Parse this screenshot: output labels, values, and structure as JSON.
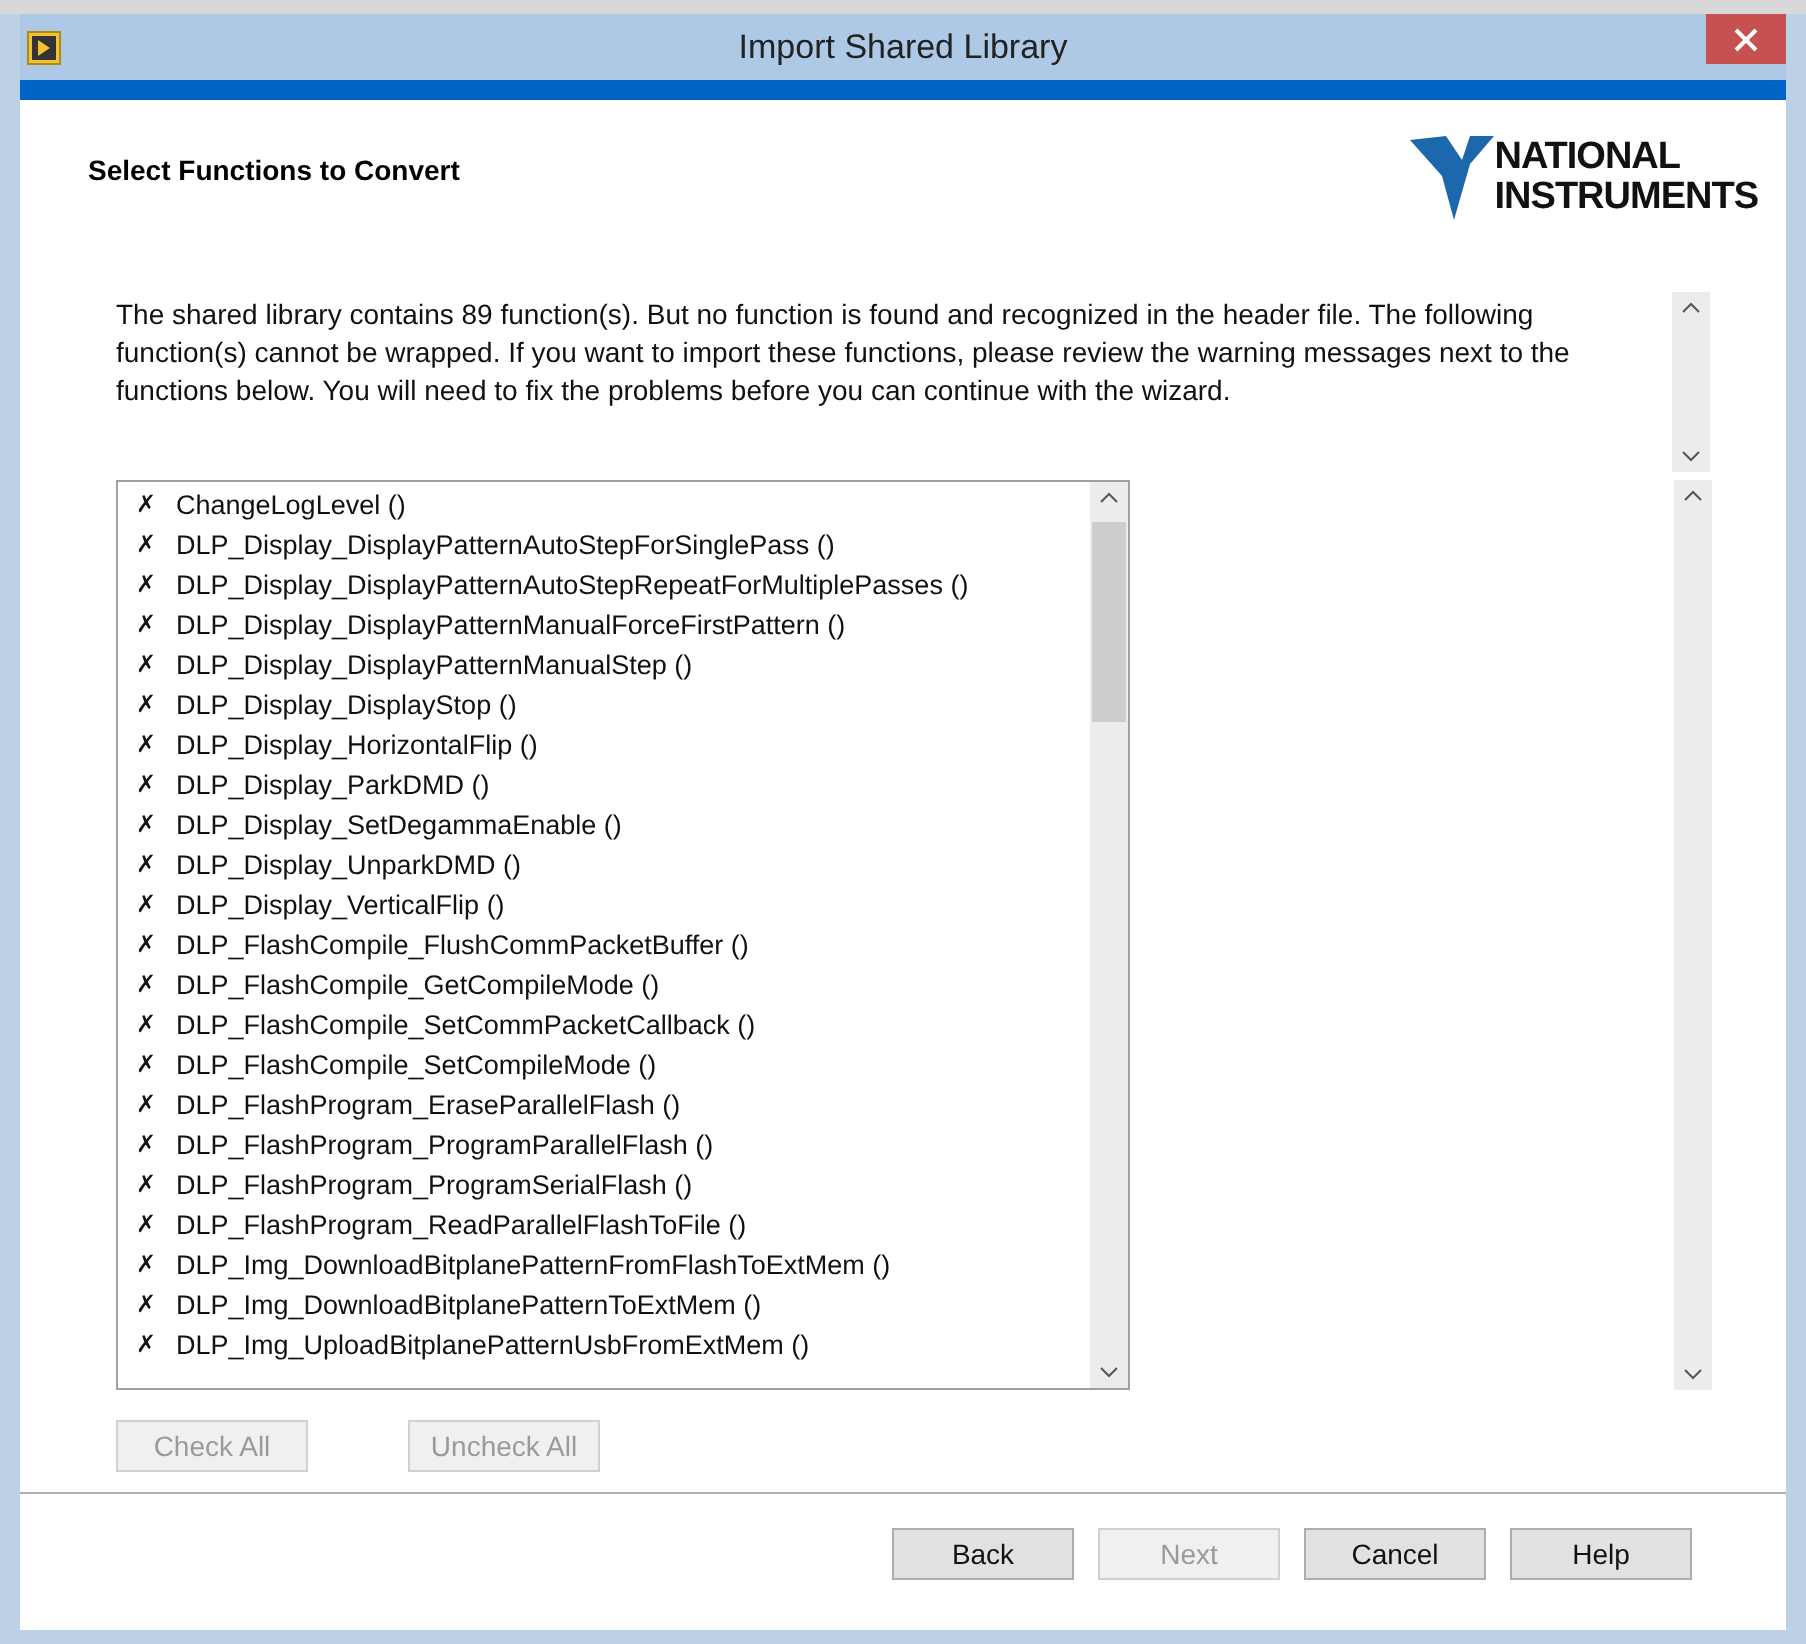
{
  "window": {
    "title": "Import Shared Library"
  },
  "header": {
    "title": "Select Functions to Convert"
  },
  "logo": {
    "line_1": "NATIONAL",
    "line_2": "INSTRUMENTS"
  },
  "description": "The shared library contains 89 function(s). But no function is found and recognized in the header file. The following function(s) cannot be wrapped. If you want to import these functions, please review the warning messages next to the functions below. You will need to fix the problems before you can continue with the wizard.",
  "functions": [
    {
      "mark": "✗",
      "name": "ChangeLogLevel ()"
    },
    {
      "mark": "✗",
      "name": "DLP_Display_DisplayPatternAutoStepForSinglePass ()"
    },
    {
      "mark": "✗",
      "name": "DLP_Display_DisplayPatternAutoStepRepeatForMultiplePasses ()"
    },
    {
      "mark": "✗",
      "name": "DLP_Display_DisplayPatternManualForceFirstPattern ()"
    },
    {
      "mark": "✗",
      "name": "DLP_Display_DisplayPatternManualStep ()"
    },
    {
      "mark": "✗",
      "name": "DLP_Display_DisplayStop ()"
    },
    {
      "mark": "✗",
      "name": "DLP_Display_HorizontalFlip ()"
    },
    {
      "mark": "✗",
      "name": "DLP_Display_ParkDMD ()"
    },
    {
      "mark": "✗",
      "name": "DLP_Display_SetDegammaEnable ()"
    },
    {
      "mark": "✗",
      "name": "DLP_Display_UnparkDMD ()"
    },
    {
      "mark": "✗",
      "name": "DLP_Display_VerticalFlip ()"
    },
    {
      "mark": "✗",
      "name": "DLP_FlashCompile_FlushCommPacketBuffer ()"
    },
    {
      "mark": "✗",
      "name": "DLP_FlashCompile_GetCompileMode ()"
    },
    {
      "mark": "✗",
      "name": "DLP_FlashCompile_SetCommPacketCallback ()"
    },
    {
      "mark": "✗",
      "name": "DLP_FlashCompile_SetCompileMode ()"
    },
    {
      "mark": "✗",
      "name": "DLP_FlashProgram_EraseParallelFlash ()"
    },
    {
      "mark": "✗",
      "name": "DLP_FlashProgram_ProgramParallelFlash ()"
    },
    {
      "mark": "✗",
      "name": "DLP_FlashProgram_ProgramSerialFlash ()"
    },
    {
      "mark": "✗",
      "name": "DLP_FlashProgram_ReadParallelFlashToFile ()"
    },
    {
      "mark": "✗",
      "name": "DLP_Img_DownloadBitplanePatternFromFlashToExtMem ()"
    },
    {
      "mark": "✗",
      "name": "DLP_Img_DownloadBitplanePatternToExtMem ()"
    },
    {
      "mark": "✗",
      "name": "DLP_Img_UploadBitplanePatternUsbFromExtMem ()"
    }
  ],
  "list_buttons": [
    {
      "label": "Check All",
      "disabled": true
    },
    {
      "label": "Uncheck All",
      "disabled": true
    }
  ],
  "buttons": [
    {
      "label": "Back",
      "disabled": false
    },
    {
      "label": "Next",
      "disabled": true
    },
    {
      "label": "Cancel",
      "disabled": false
    },
    {
      "label": "Help",
      "disabled": false
    }
  ]
}
